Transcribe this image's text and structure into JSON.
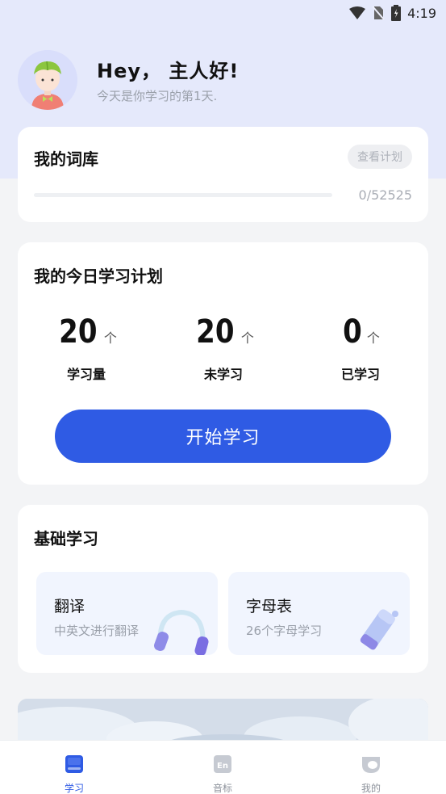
{
  "status_bar": {
    "time": "4:19"
  },
  "header": {
    "greeting": "Hey， 主人好!",
    "subtitle": "今天是你学习的第1天."
  },
  "vocab_card": {
    "title": "我的词库",
    "plan_button": "查看计划",
    "progress_text": "0/52525",
    "progress_fraction": 0
  },
  "plan_card": {
    "title": "我的今日学习计划",
    "stats": [
      {
        "value": "20",
        "unit": "个",
        "label": "学习量"
      },
      {
        "value": "20",
        "unit": "个",
        "label": "未学习"
      },
      {
        "value": "0",
        "unit": "个",
        "label": "已学习"
      }
    ],
    "start_button": "开始学习"
  },
  "basic_card": {
    "title": "基础学习",
    "tiles": [
      {
        "title": "翻译",
        "subtitle": "中英文进行翻译",
        "icon": "headphones-icon"
      },
      {
        "title": "字母表",
        "subtitle": "26个字母学习",
        "icon": "pencil-icon"
      }
    ]
  },
  "tab_bar": {
    "tabs": [
      {
        "label": "学习",
        "icon": "book-icon",
        "active": true
      },
      {
        "label": "音标",
        "icon": "en-phonetic-icon",
        "active": false
      },
      {
        "label": "我的",
        "icon": "profile-icon",
        "active": false
      }
    ]
  },
  "colors": {
    "accent": "#2f5be4",
    "header_bg": "#e5e9fb",
    "page_bg": "#f3f4f6"
  }
}
